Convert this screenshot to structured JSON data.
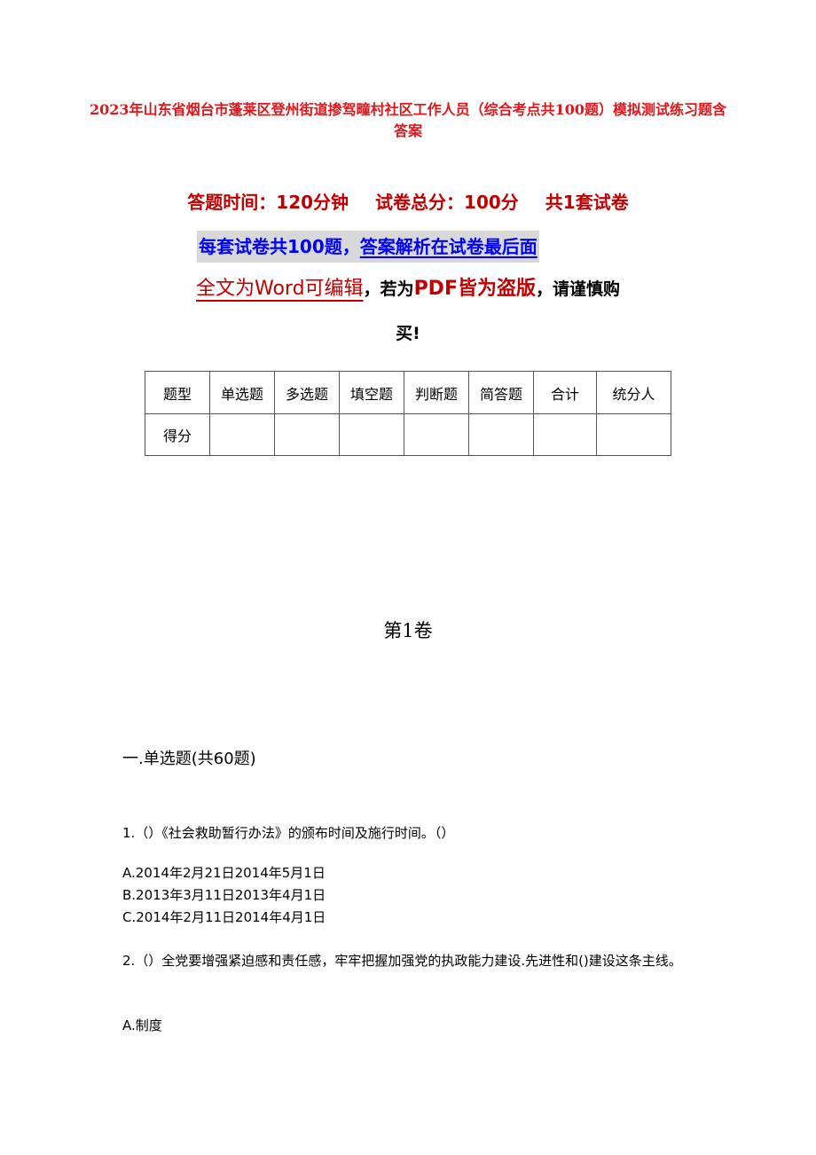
{
  "document": {
    "title": "2023年山东省烟台市蓬莱区登州街道掺驾疃村社区工作人员（综合考点共100题）模拟测试练习题含答案",
    "meta": {
      "time": "答题时间：120分钟",
      "total_score": "试卷总分：100分",
      "sets": "共1套试卷"
    },
    "notice": {
      "part1": "每套试卷共100题，",
      "part2": "答案解析在试卷最后面"
    },
    "edit_notice": {
      "part1": "全文为Word可编辑",
      "part2": "，若为",
      "part3": "PDF皆为盗版",
      "part4": "，请谨慎购",
      "part5": "买!"
    },
    "score_table": {
      "headers": [
        "题型",
        "单选题",
        "多选题",
        "填空题",
        "判断题",
        "简答题",
        "合计",
        "统分人"
      ],
      "row_label": "得分",
      "values": [
        "",
        "",
        "",
        "",
        "",
        "",
        ""
      ]
    },
    "volume_title": "第1卷",
    "section_title": "一.单选题(共60题)",
    "questions": [
      {
        "stem": "1.（）《社会救助暂行办法》的颁布时间及施行时间。（）",
        "options": [
          "A.2014年2月21日2014年5月1日",
          "B.2013年3月11日2013年4月1日",
          "C.2014年2月11日2014年4月1日"
        ]
      },
      {
        "stem": "2.（）全党要增强紧迫感和责任感，牢牢把握加强党的执政能力建设.先进性和()建设这条主线。",
        "options": [
          "A.制度"
        ]
      }
    ]
  }
}
